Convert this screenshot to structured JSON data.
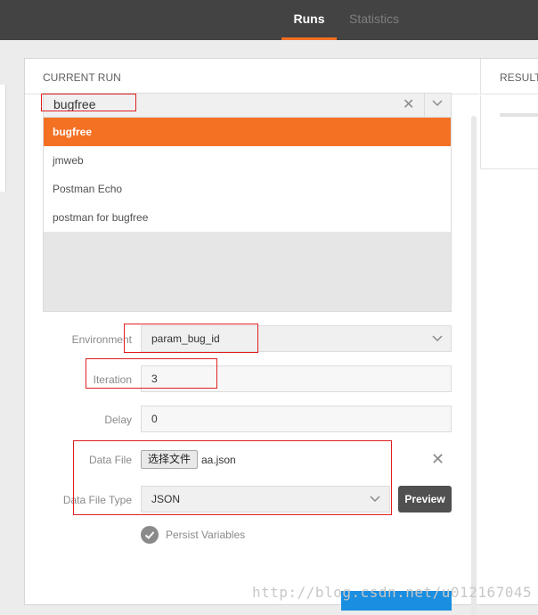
{
  "header": {
    "tabs": [
      {
        "label": "Runs",
        "active": true
      },
      {
        "label": "Statistics",
        "active": false
      }
    ],
    "accent_color": "#f47023",
    "background_color": "#434343"
  },
  "current_run": {
    "heading": "CURRENT RUN",
    "results_heading": "RESULTS",
    "collection_select": {
      "value": "bugfree",
      "clear_icon": "close-icon",
      "toggle_icon": "chevron-down-icon",
      "options": [
        {
          "label": "bugfree",
          "selected": true
        },
        {
          "label": "jmweb",
          "selected": false
        },
        {
          "label": "Postman Echo",
          "selected": false
        },
        {
          "label": "postman for bugfree",
          "selected": false
        }
      ]
    },
    "environment": {
      "label": "Environment",
      "value": "param_bug_id"
    },
    "iteration": {
      "label": "Iteration",
      "value": "3"
    },
    "delay": {
      "label": "Delay",
      "value": "0"
    },
    "data_file": {
      "label": "Data File",
      "button_label": "选择文件",
      "file_name": "aa.json"
    },
    "data_file_type": {
      "label": "Data File Type",
      "value": "JSON"
    },
    "preview_label": "Preview",
    "persist_variables": {
      "label": "Persist Variables",
      "checked": true
    }
  },
  "watermark": "http://blog.csdn.net/u012167045",
  "annotation_color": "#e02020",
  "start_button_color": "#1a8ee0"
}
